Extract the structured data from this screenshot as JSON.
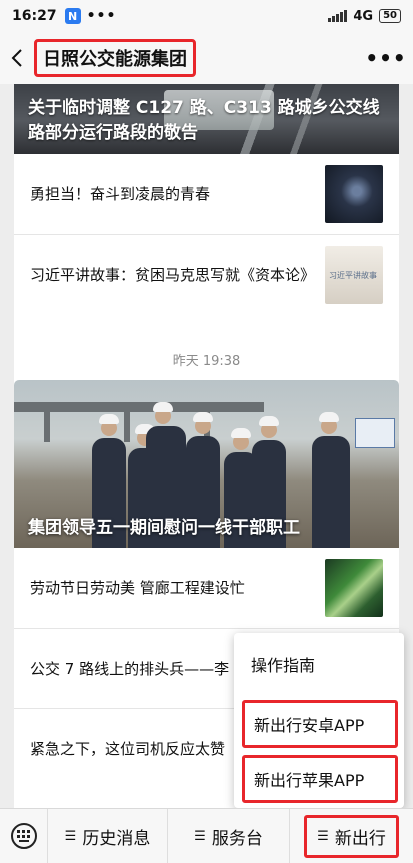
{
  "status_bar": {
    "time": "16:27",
    "app_badge": "N",
    "dots": "•••",
    "network": "4G",
    "battery": "50"
  },
  "nav": {
    "title": "日照公交能源集团",
    "more": "•••"
  },
  "feed": {
    "card1": {
      "hero_title": "关于临时调整 C127 路、C313 路城乡公交线路部分运行路段的敬告",
      "articles": [
        {
          "title": "勇担当！奋斗到凌晨的青春"
        },
        {
          "title": "习近平讲故事：贫困马克思写就《资本论》",
          "thumb_text": "习近平讲故事"
        }
      ]
    },
    "timestamp": "昨天 19:38",
    "card2": {
      "hero_title": "集团领导五一期间慰问一线干部职工",
      "articles": [
        {
          "title": "劳动节日劳动美 管廊工程建设忙"
        },
        {
          "title": "公交 7 路线上的排头兵——李"
        },
        {
          "title": "紧急之下，这位司机反应太赞"
        }
      ]
    }
  },
  "popup_menu": {
    "items": [
      {
        "label": "操作指南"
      },
      {
        "label": "新出行安卓APP"
      },
      {
        "label": "新出行苹果APP"
      }
    ]
  },
  "bottom_menu": {
    "tabs": [
      {
        "label": "历史消息"
      },
      {
        "label": "服务台"
      },
      {
        "label": "新出行"
      }
    ]
  },
  "colors": {
    "highlight_box": "#e8262b",
    "background": "#ededed"
  }
}
